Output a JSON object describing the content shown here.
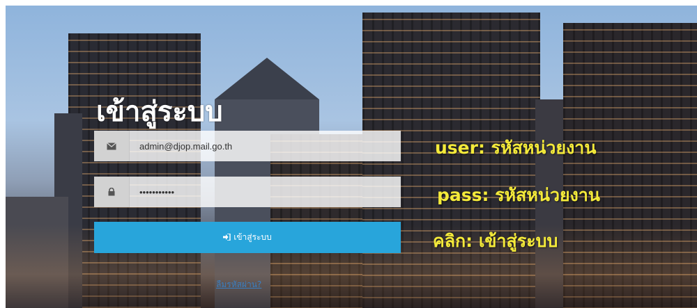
{
  "title": "เข้าสู่ระบบ",
  "email": {
    "value": "admin@djop.mail.go.th"
  },
  "password": {
    "value": "•••••••••••"
  },
  "login_button": {
    "label": "เข้าสู่ระบบ"
  },
  "forgot_link": "ลืมรหัสผ่าน?",
  "hints": {
    "user": "user: รหัสหน่วยงาน",
    "pass": "pass: รหัสหน่วยงาน",
    "click": "คลิก: เข้าสู่ระบบ"
  },
  "icons": {
    "email": "envelope-icon",
    "password": "lock-icon",
    "login": "sign-in-icon"
  },
  "colors": {
    "button": "#28a5db",
    "hint_text": "#f4ea3a",
    "link": "#3a7fc2"
  }
}
